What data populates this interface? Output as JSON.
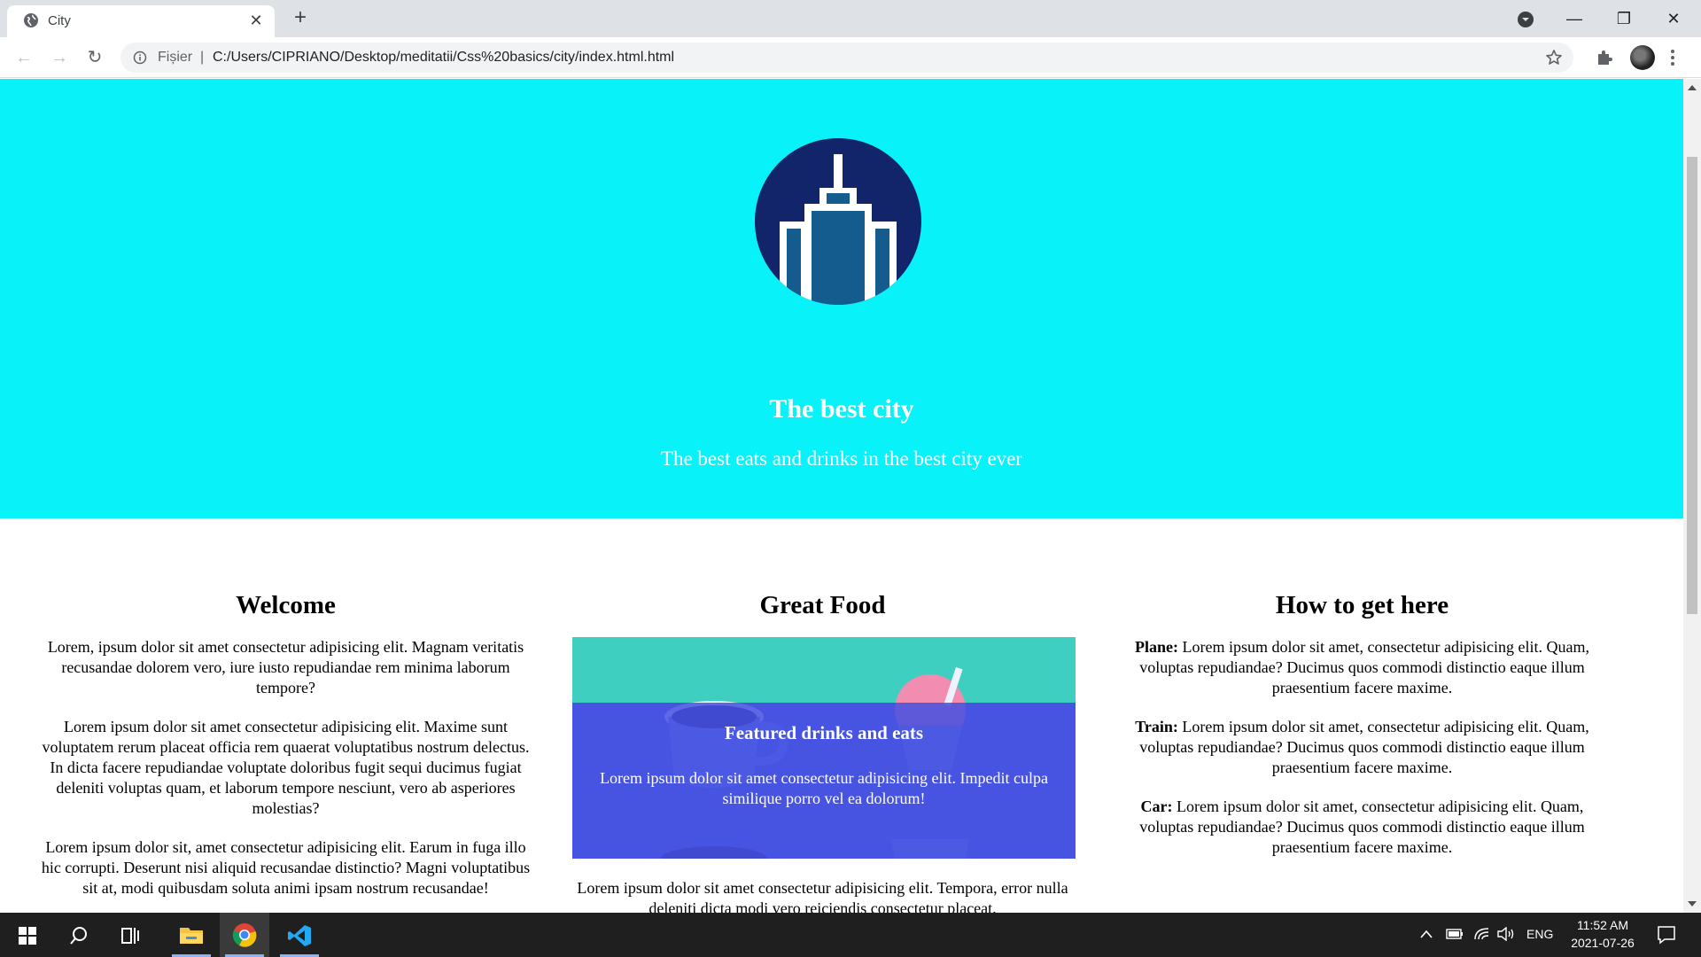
{
  "browser": {
    "tab_title": "City",
    "tab_close": "✕",
    "new_tab": "+",
    "omnibox": {
      "scheme_label": "Fișier",
      "separator": "|",
      "url": "C:/Users/CIPRIANO/Desktop/meditatii/Css%20basics/city/index.html.html"
    },
    "window_buttons": {
      "minimize": "—",
      "restore": "❐",
      "close": "✕"
    },
    "nav": {
      "back": "←",
      "forward": "→",
      "reload": "↻"
    }
  },
  "page": {
    "hero": {
      "title": "The best city",
      "subtitle": "The best eats and drinks in the best city ever",
      "colors": {
        "background": "#08f2fa",
        "logo_circle": "#12256b",
        "logo_tower": "#155c8e"
      }
    },
    "welcome": {
      "heading": "Welcome",
      "paragraphs": [
        "Lorem, ipsum dolor sit amet consectetur adipisicing elit. Magnam veritatis recusandae dolorem vero, iure iusto repudiandae rem minima laborum tempore?",
        "Lorem ipsum dolor sit amet consectetur adipisicing elit. Maxime sunt voluptatem rerum placeat officia rem quaerat voluptatibus nostrum delectus. In dicta facere repudiandae voluptate doloribus fugit sequi ducimus fugiat deleniti voluptas quam, et laborum tempore nesciunt, vero ab asperiores molestias?",
        "Lorem ipsum dolor sit, amet consectetur adipisicing elit. Earum in fuga illo hic corrupti. Deserunt nisi aliquid recusandae distinctio? Magni voluptatibus sit at, modi quibusdam soluta animi ipsam nostrum recusandae!"
      ]
    },
    "food": {
      "heading": "Great Food",
      "feature_title": "Featured drinks and eats",
      "feature_text": "Lorem ipsum dolor sit amet consectetur adipisicing elit. Impedit culpa similique porro vel ea dolorum!",
      "below_text": "Lorem ipsum dolor sit amet consectetur adipisicing elit. Tempora, error nulla deleniti dicta modi vero reiciendis consectetur placeat."
    },
    "directions": {
      "heading": "How to get here",
      "items": [
        {
          "label": "Plane:",
          "text": " Lorem ipsum dolor sit amet, consectetur adipisicing elit. Quam, voluptas repudiandae? Ducimus quos commodi distinctio eaque illum praesentium facere maxime."
        },
        {
          "label": "Train:",
          "text": " Lorem ipsum dolor sit amet, consectetur adipisicing elit. Quam, voluptas repudiandae? Ducimus quos commodi distinctio eaque illum praesentium facere maxime."
        },
        {
          "label": "Car:",
          "text": " Lorem ipsum dolor sit amet, consectetur adipisicing elit. Quam, voluptas repudiandae? Ducimus quos commodi distinctio eaque illum praesentium facere maxime."
        }
      ]
    }
  },
  "taskbar": {
    "language": "ENG",
    "time": "11:52 AM",
    "date": "2021-07-26",
    "icons": [
      "windows-start-icon",
      "search-icon",
      "task-view-icon",
      "file-explorer-icon",
      "chrome-icon",
      "vscode-icon"
    ]
  }
}
